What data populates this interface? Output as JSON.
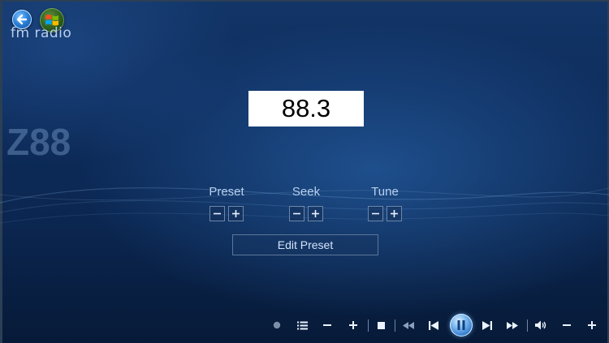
{
  "app": {
    "title": "fm radio"
  },
  "station": {
    "name": "Z88",
    "frequency": "88.3"
  },
  "controls": {
    "preset_label": "Preset",
    "seek_label": "Seek",
    "tune_label": "Tune",
    "edit_preset_label": "Edit Preset"
  },
  "icons": {
    "back": "back-arrow-icon",
    "start": "windows-logo-icon",
    "record": "record-dot-icon",
    "playlist": "list-icon",
    "play_pause": "pause-icon"
  },
  "colors": {
    "background_top": "#123567",
    "background_bottom": "#071a38",
    "text": "#b9d1ee",
    "frequency_box": "#ffffff"
  }
}
